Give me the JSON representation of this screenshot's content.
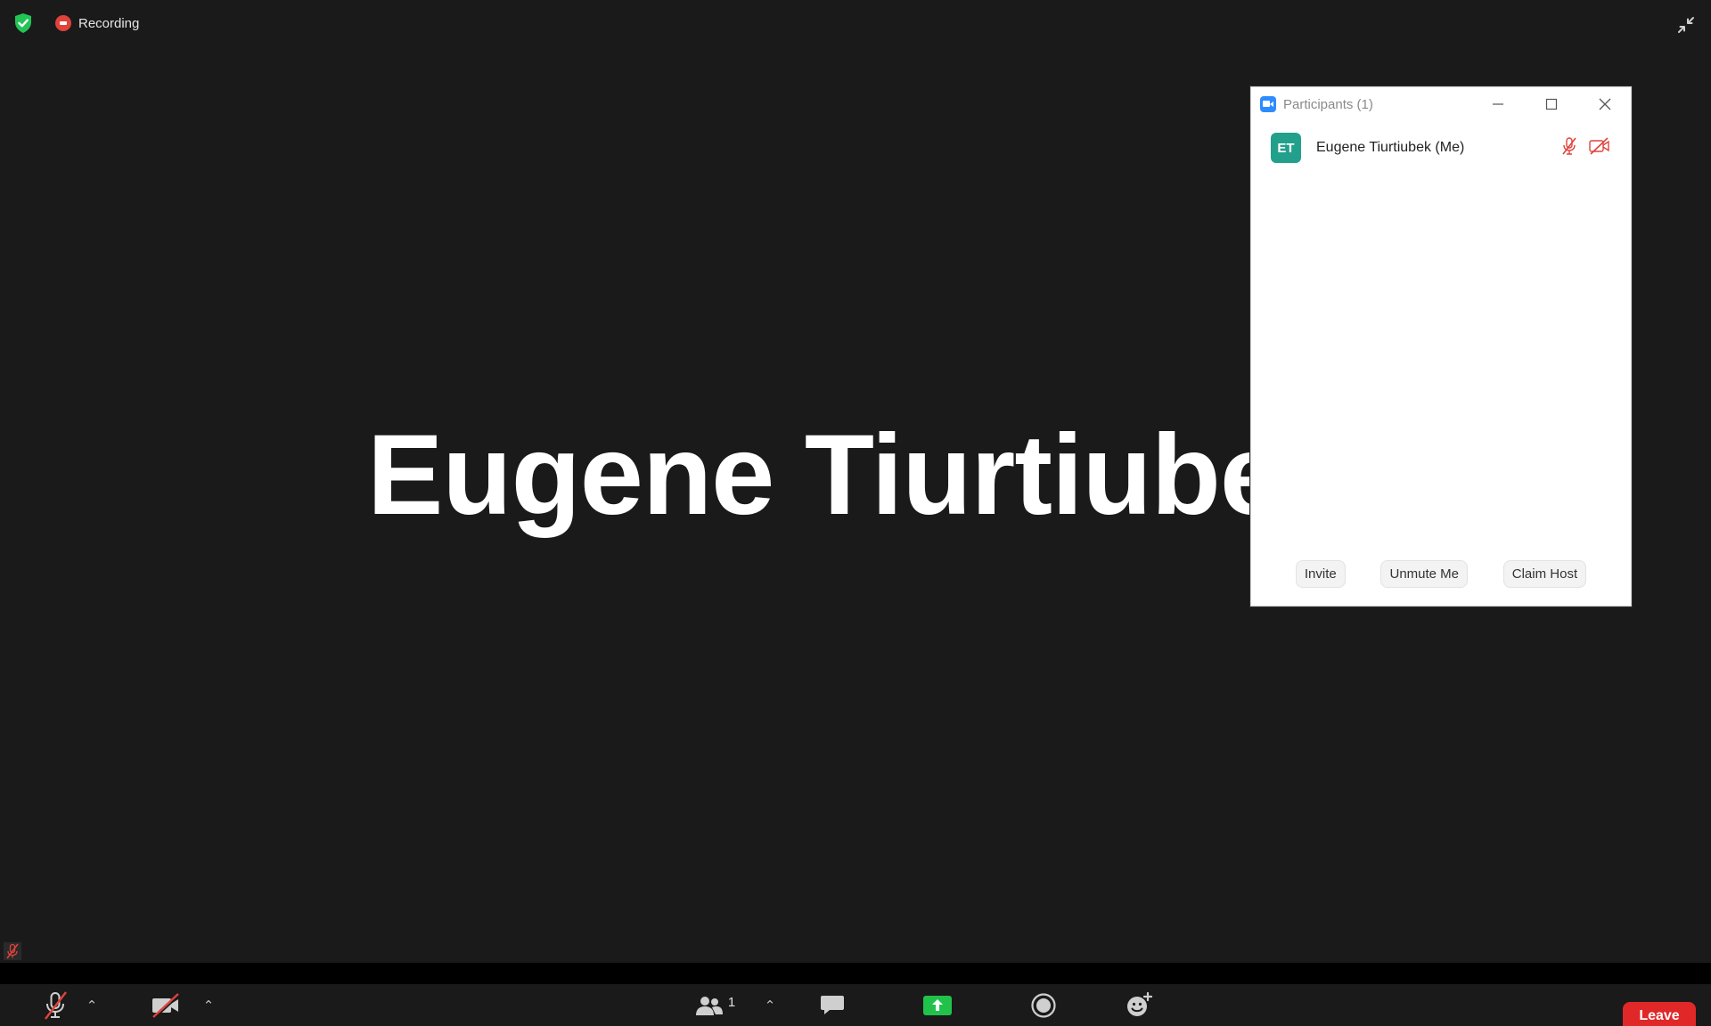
{
  "status": {
    "recording_label": "Recording"
  },
  "video": {
    "participant_display_name": "Eugene Tiurtiube"
  },
  "participants_window": {
    "title": "Participants (1)",
    "participants": [
      {
        "initials": "ET",
        "name": "Eugene Tiurtiubek (Me)",
        "avatar_color": "#23a08c",
        "muted": true,
        "video_off": true
      }
    ],
    "buttons": {
      "invite": "Invite",
      "unmute": "Unmute Me",
      "claim_host": "Claim Host"
    }
  },
  "toolbar": {
    "participant_count": "1",
    "leave_label": "Leave"
  },
  "colors": {
    "background": "#1a1a1a",
    "recording": "#e0423c",
    "share_green": "#21c24b",
    "leave_red": "#e02828",
    "security_green": "#23c456",
    "muted_red": "#e0423c"
  }
}
